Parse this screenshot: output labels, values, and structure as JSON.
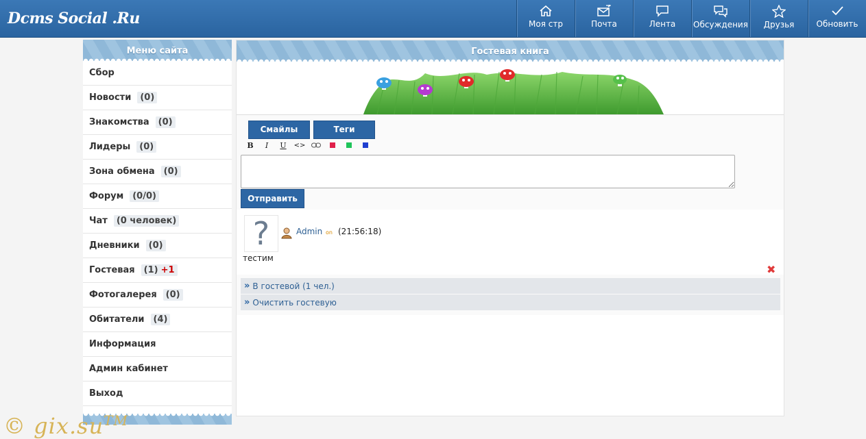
{
  "header": {
    "logo": "Dcms Social .Ru",
    "nav": [
      {
        "label": "Моя стр",
        "icon": "home-icon"
      },
      {
        "label": "Почта",
        "icon": "mail-icon"
      },
      {
        "label": "Лента",
        "icon": "chat-bubble-icon"
      },
      {
        "label": "Обсуждения",
        "icon": "chat-bubbles-icon"
      },
      {
        "label": "Друзья",
        "icon": "star-icon"
      },
      {
        "label": "Обновить",
        "icon": "check-icon"
      }
    ]
  },
  "sidebar": {
    "title": "Меню сайта",
    "items": [
      {
        "label": "Сбор",
        "count": "",
        "extra": ""
      },
      {
        "label": "Новости",
        "count": "(0)",
        "extra": ""
      },
      {
        "label": "Знакомства",
        "count": "(0)",
        "extra": ""
      },
      {
        "label": "Лидеры",
        "count": "(0)",
        "extra": ""
      },
      {
        "label": "Зона обмена",
        "count": "(0)",
        "extra": ""
      },
      {
        "label": "Форум",
        "count": "(0/0)",
        "extra": ""
      },
      {
        "label": "Чат",
        "count": "(0 человек)",
        "extra": ""
      },
      {
        "label": "Дневники",
        "count": "(0)",
        "extra": ""
      },
      {
        "label": "Гостевая",
        "count": "(1)",
        "extra": "+1"
      },
      {
        "label": "Фотогалерея",
        "count": "(0)",
        "extra": ""
      },
      {
        "label": "Обитатели",
        "count": "(4)",
        "extra": ""
      },
      {
        "label": "Информация",
        "count": "",
        "extra": ""
      },
      {
        "label": "Админ кабинет",
        "count": "",
        "extra": ""
      },
      {
        "label": "Выход",
        "count": "",
        "extra": ""
      }
    ]
  },
  "main": {
    "title": "Гостевая книга",
    "tabs": {
      "smiles": "Смайлы",
      "tags": "Теги"
    },
    "format_buttons": [
      {
        "label": "B",
        "icon": "bold-icon"
      },
      {
        "label": "I",
        "icon": "italic-icon"
      },
      {
        "label": "U",
        "icon": "underline-icon"
      },
      {
        "label": "<>",
        "icon": "code-icon"
      },
      {
        "label": "",
        "icon": "link-icon"
      },
      {
        "label": "",
        "icon": "red-color-icon",
        "color": "#e0204a"
      },
      {
        "label": "",
        "icon": "green-color-icon",
        "color": "#1fc45a"
      },
      {
        "label": "",
        "icon": "blue-color-icon",
        "color": "#1f3fd0"
      }
    ],
    "message_value": "",
    "send_label": "Отправить",
    "post": {
      "avatar": "?",
      "author": "Admin",
      "status": "on",
      "time": "(21:56:18)",
      "text": "тестим"
    },
    "links": {
      "in_guestbook": "В гостевой (1 чел.)",
      "clear": "Очистить гостевую"
    }
  },
  "watermark": {
    "text": "© gix.su",
    "tm": "TM"
  },
  "colors": {
    "header": "#2f6aa6",
    "accent": "#2d66a4",
    "plus": "#cc0000",
    "delete": "#e03a3a"
  }
}
